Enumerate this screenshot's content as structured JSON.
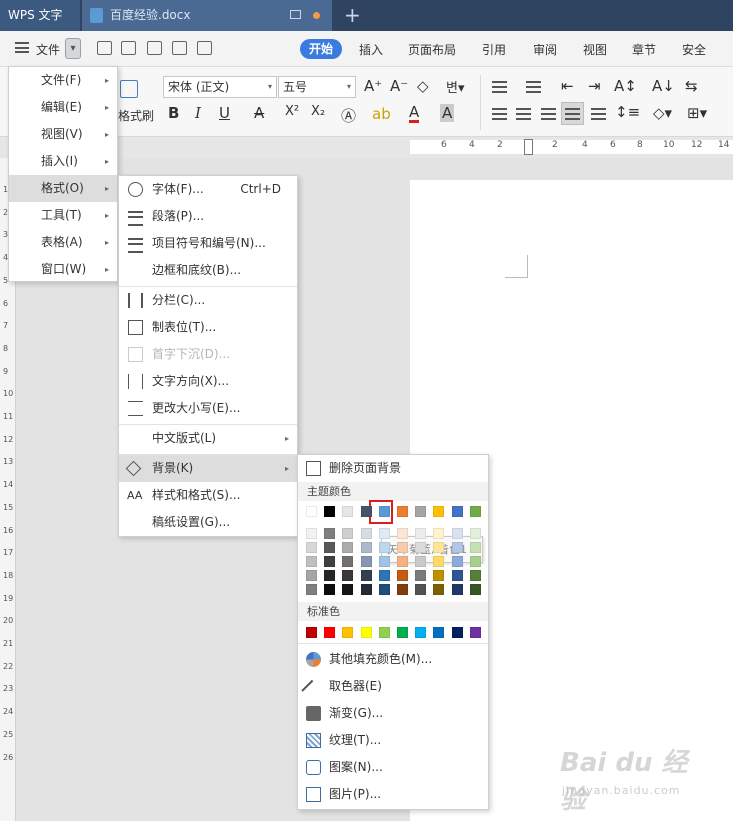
{
  "titlebar": {
    "app_name": "WPS 文字",
    "doc_name": "百度经验.docx",
    "new_tab": "+"
  },
  "menubar": {
    "file_label": "文件",
    "tabs": [
      "开始",
      "插入",
      "页面布局",
      "引用",
      "审阅",
      "视图",
      "章节",
      "安全"
    ]
  },
  "ribbon": {
    "brush_label": "格式刷",
    "font_name": "宋体 (正文)",
    "font_size": "五号",
    "bold": "B",
    "italic": "I",
    "underline": "U",
    "strike": "A",
    "superscript": "X²",
    "subscript": "X₂",
    "font_color": "A",
    "char_shade": "A"
  },
  "ruler": {
    "numbers": [
      "6",
      "4",
      "2",
      "2",
      "4",
      "6",
      "8",
      "10",
      "12",
      "14"
    ]
  },
  "vruler": {
    "numbers": [
      "1",
      "2",
      "3",
      "4",
      "5",
      "6",
      "7",
      "8",
      "9",
      "10",
      "11",
      "12",
      "13",
      "14",
      "15",
      "16",
      "17",
      "18",
      "19",
      "20",
      "21",
      "22",
      "23",
      "24",
      "25",
      "26"
    ]
  },
  "menu_level1": [
    {
      "label": "文件(F)"
    },
    {
      "label": "编辑(E)"
    },
    {
      "label": "视图(V)"
    },
    {
      "label": "插入(I)"
    },
    {
      "label": "格式(O)"
    },
    {
      "label": "工具(T)"
    },
    {
      "label": "表格(A)"
    },
    {
      "label": "窗口(W)"
    }
  ],
  "menu_level2": [
    {
      "label": "字体(F)...",
      "shortcut": "Ctrl+D"
    },
    {
      "label": "段落(P)..."
    },
    {
      "label": "项目符号和编号(N)..."
    },
    {
      "label": "边框和底纹(B)..."
    },
    {
      "label": "分栏(C)..."
    },
    {
      "label": "制表位(T)..."
    },
    {
      "label": "首字下沉(D)..."
    },
    {
      "label": "文字方向(X)..."
    },
    {
      "label": "更改大小写(E)..."
    },
    {
      "label": "中文版式(L)"
    },
    {
      "label": "背景(K)"
    },
    {
      "label": "样式和格式(S)..."
    },
    {
      "label": "稿纸设置(G)..."
    }
  ],
  "menu_level3": {
    "remove_bg": "删除页面背景",
    "theme_colors_title": "主题颜色",
    "standard_colors_title": "标准色",
    "tooltip": "矢车菊蓝, 着色1",
    "theme_top": [
      "#ffffff",
      "#000000",
      "#e7e6e6",
      "#44546a",
      "#5b9bd5",
      "#ed7d31",
      "#a5a5a5",
      "#ffc000",
      "#4472c4",
      "#70ad47"
    ],
    "theme_shades": [
      [
        "#f2f2f2",
        "#7f7f7f",
        "#d0cece",
        "#d6dce4",
        "#deebf6",
        "#fbe5d5",
        "#ededed",
        "#fff2cc",
        "#d9e2f3",
        "#e2efd9"
      ],
      [
        "#d8d8d8",
        "#595959",
        "#aeabab",
        "#adb9ca",
        "#bdd7ee",
        "#f7cbac",
        "#dbdbdb",
        "#fee599",
        "#b4c6e7",
        "#c5e0b3"
      ],
      [
        "#bfbfbf",
        "#3f3f3f",
        "#757070",
        "#8496b0",
        "#9dc3e6",
        "#f4b183",
        "#c9c9c9",
        "#ffd965",
        "#8eaadb",
        "#a8d08d"
      ],
      [
        "#a5a5a5",
        "#262626",
        "#3a3838",
        "#323f4f",
        "#2e75b5",
        "#c55a11",
        "#7b7b7b",
        "#bf9000",
        "#2f5496",
        "#538135"
      ],
      [
        "#7f7f7f",
        "#0c0c0c",
        "#171616",
        "#222a35",
        "#1e4e79",
        "#833c0b",
        "#525252",
        "#7f6000",
        "#1f3864",
        "#375623"
      ]
    ],
    "standard": [
      "#c00000",
      "#ff0000",
      "#ffc000",
      "#ffff00",
      "#92d050",
      "#00b050",
      "#00b0f0",
      "#0070c0",
      "#002060",
      "#7030a0"
    ],
    "items": [
      {
        "label": "其他填充颜色(M)..."
      },
      {
        "label": "取色器(E)"
      },
      {
        "label": "渐变(G)..."
      },
      {
        "label": "纹理(T)..."
      },
      {
        "label": "图案(N)..."
      },
      {
        "label": "图片(P)..."
      }
    ]
  },
  "watermark": {
    "main": "Bai du 经验",
    "sub": "jingyan.baidu.com"
  }
}
